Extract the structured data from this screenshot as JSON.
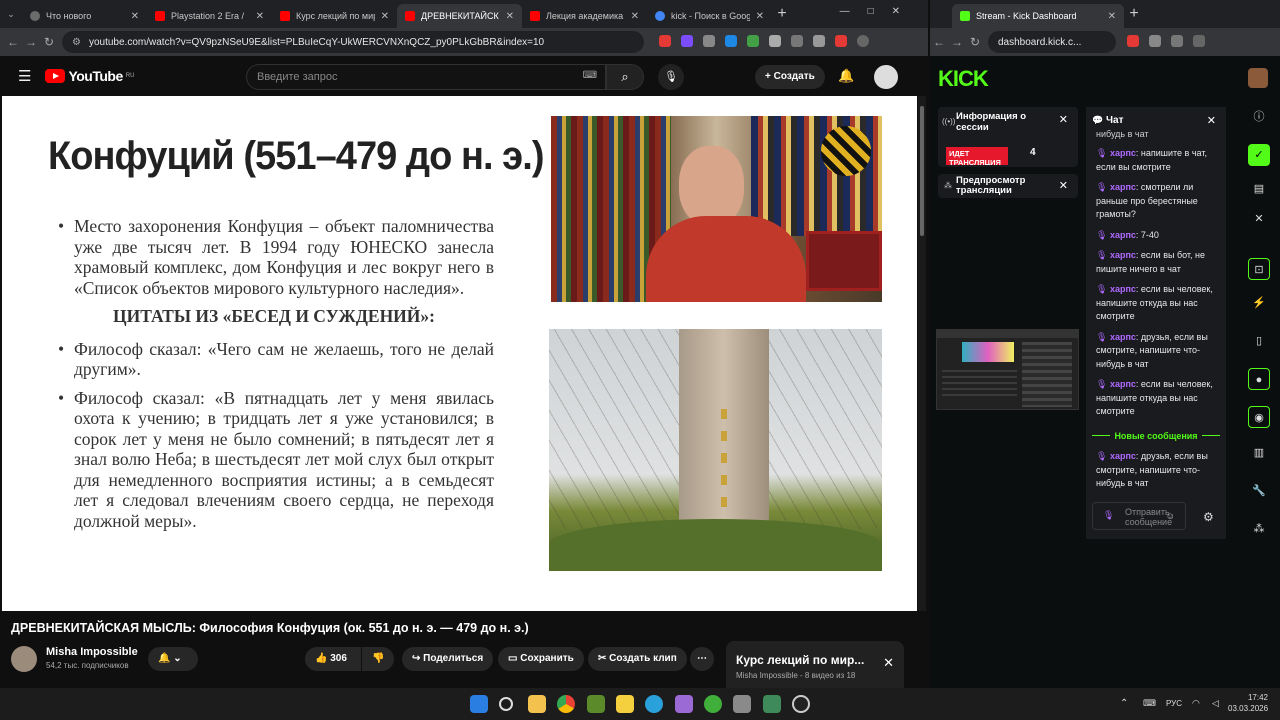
{
  "left_browser": {
    "tabs": [
      {
        "label": "Что нового",
        "color": "#6b6b6b"
      },
      {
        "label": "Playstation 2 Era /",
        "color": "#ff0000"
      },
      {
        "label": "Курс лекций по мир",
        "color": "#ff0000"
      },
      {
        "label": "ДРЕВНЕКИТАЙСК",
        "color": "#ff0000",
        "active": true
      },
      {
        "label": "Лекция академика Р",
        "color": "#ff0000"
      },
      {
        "label": "kick - Поиск в Google",
        "color": "#4285f4"
      }
    ],
    "url": "youtube.com/watch?v=QV9pzNSeU9E&list=PLBuIeCqY-UkWERCVNXnQCZ_py0PLkGbBR&index=10"
  },
  "youtube": {
    "logo": "YouTube",
    "logo_region": "RU",
    "search_placeholder": "Введите запрос",
    "create_label": "Создать",
    "slide": {
      "title": "Конфуций (551–479 до н. э.)",
      "bullet1": "Место захоронения Конфуция – объект паломничества уже две тысяч лет. В 1994 году ЮНЕСКО занесла храмовый комплекс, дом Конфуция и лес вокруг него в «Список объектов мирового культурного наследия».",
      "heading": "ЦИТАТЫ ИЗ «БЕСЕД И СУЖДЕНИЙ»:",
      "bullet2": "Философ сказал: «Чего сам не желаешь, того не делай другим».",
      "bullet3": "Философ сказал: «В пятнадцать лет у меня явилась охота к учению; в тридцать лет я уже установился; в сорок лет у меня не было сомнений; в пятьдесят лет я знал волю Неба; в шестьдесят лет мой слух был открыт для немедленного восприятия истины; а в семьдесят лет я следовал влечениям своего сердца, не переходя должной меры»."
    },
    "video_title": "ДРЕВНЕКИТАЙСКАЯ МЫСЛЬ: Философия Конфуция (ок. 551 до н. э. — 479 до н. э.)",
    "channel": "Misha Impossible",
    "subscribers": "54,2 тыс. подписчиков",
    "likes": "306",
    "share": "Поделиться",
    "save": "Сохранить",
    "clip": "Создать клип",
    "playlist_title": "Курс лекций по мир...",
    "playlist_sub": "Misha Impossible - 8 видео из 18"
  },
  "right_browser": {
    "tab_label": "Stream - Kick Dashboard",
    "url": "dashboard.kick.c..."
  },
  "kick": {
    "logo": "KICK",
    "session_title": "Информация о сессии",
    "live_label": "ИДЕТ ТРАНСЛЯЦИЯ",
    "live_count": "4",
    "preview_title": "Предпросмотр трансляции",
    "chat_title": "Чат",
    "chat_top": "нибудь в чат",
    "messages": [
      {
        "user": "харпс",
        "text": ": напишите в чат, если вы смотрите"
      },
      {
        "user": "харпс",
        "text": ": смотрели ли раньше про берестяные грамоты?"
      },
      {
        "user": "харпс",
        "text": ": 7-40"
      },
      {
        "user": "харпс",
        "text": ": если вы бот, не пишите ничего в чат"
      },
      {
        "user": "харпс",
        "text": ": если вы человек, напишите откуда вы нас смотрите"
      },
      {
        "user": "харпс",
        "text": ": друзья, если вы смотрите, напишите что-нибудь в чат"
      },
      {
        "user": "харпс",
        "text": ": если вы человек, напишите откуда вы нас смотрите"
      }
    ],
    "new_messages": "Новые сообщения",
    "last_message": {
      "user": "харпс",
      "text": ": друзья, если вы смотрите, напишите что-нибудь в чат"
    },
    "send_placeholder": "Отправить сообщение",
    "accent": "#53fc18"
  },
  "taskbar": {
    "lang": "РУС",
    "time": "17:42",
    "date": "03.03.2026"
  }
}
